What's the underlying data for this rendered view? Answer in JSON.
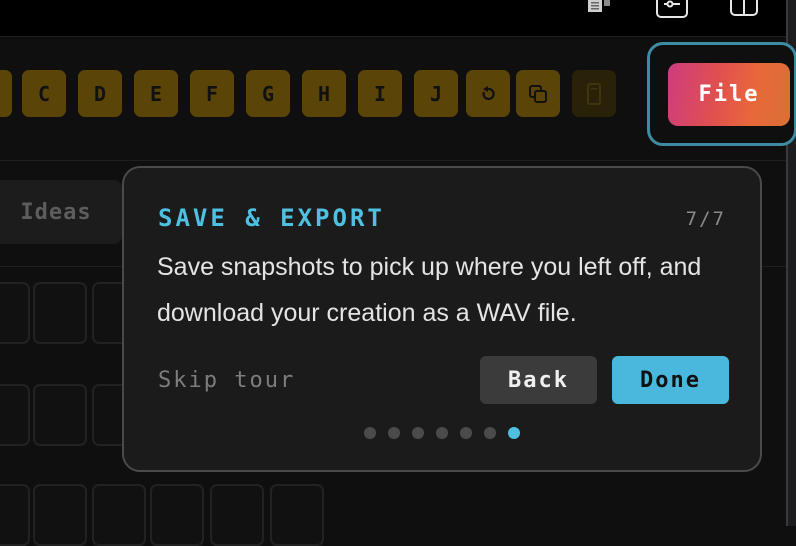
{
  "top_icons": [
    "document-stack-icon",
    "sliders-icon",
    "panel-icon"
  ],
  "keys": {
    "letters": [
      "C",
      "D",
      "E",
      "F",
      "G",
      "H",
      "I",
      "J"
    ],
    "icons": [
      "undo-icon",
      "copy-icon",
      "clear-icon"
    ]
  },
  "file_button": {
    "label": "File"
  },
  "ideas_tab": {
    "label": "Ideas"
  },
  "tour": {
    "title": "SAVE & EXPORT",
    "step": "7/7",
    "body": "Save snapshots to pick up where you left off, and download your creation as a WAV file.",
    "skip_label": "Skip tour",
    "back_label": "Back",
    "done_label": "Done",
    "total_steps": 7,
    "current_step": 7
  },
  "colors": {
    "accent": "#4ec1e3",
    "key_bg": "#5a4408",
    "file_gradient_start": "#cc3d7f",
    "file_gradient_end": "#e8683a"
  }
}
